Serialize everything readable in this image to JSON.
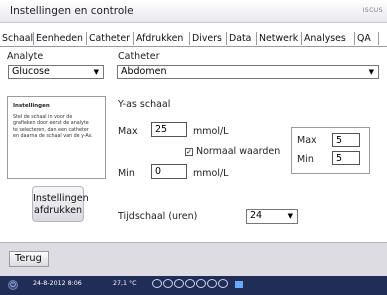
{
  "window": {
    "title": "Instellingen en controle",
    "brand": "ISCUS"
  },
  "tabs": [
    {
      "label": "Schaal",
      "active": true
    },
    {
      "label": "Eenheden"
    },
    {
      "label": "Catheter"
    },
    {
      "label": "Afdrukken"
    },
    {
      "label": "Divers"
    },
    {
      "label": "Data"
    },
    {
      "label": "Netwerk"
    },
    {
      "label": "Analyses"
    },
    {
      "label": "QA"
    }
  ],
  "analyte": {
    "label": "Analyte",
    "value": "Glucose"
  },
  "catheter": {
    "label": "Catheter",
    "value": "Abdomen"
  },
  "info": {
    "title": "Instellingen",
    "text": "Stel de schaal in voor de grafieken door eerst de analyte te selecteren, dan een catheter en daarna de schaal van de y-As."
  },
  "yaxis": {
    "title": "Y-as schaal",
    "max_label": "Max",
    "max_value": "25",
    "min_label": "Min",
    "min_value": "0",
    "unit": "mmol/L"
  },
  "normal_values": {
    "label": "Normaal waarden",
    "checked": true,
    "max_label": "Max",
    "max_value": "5",
    "min_label": "Min",
    "min_value": "5"
  },
  "timescale": {
    "label": "Tijdschaal (uren)",
    "value": "24"
  },
  "print_button": {
    "line1": "Instellingen",
    "line2": "afdrukken"
  },
  "footer": {
    "back_label": "Terug"
  },
  "status": {
    "date_time": "24-8-2012 8:06",
    "temperature": "27,1 °C"
  }
}
